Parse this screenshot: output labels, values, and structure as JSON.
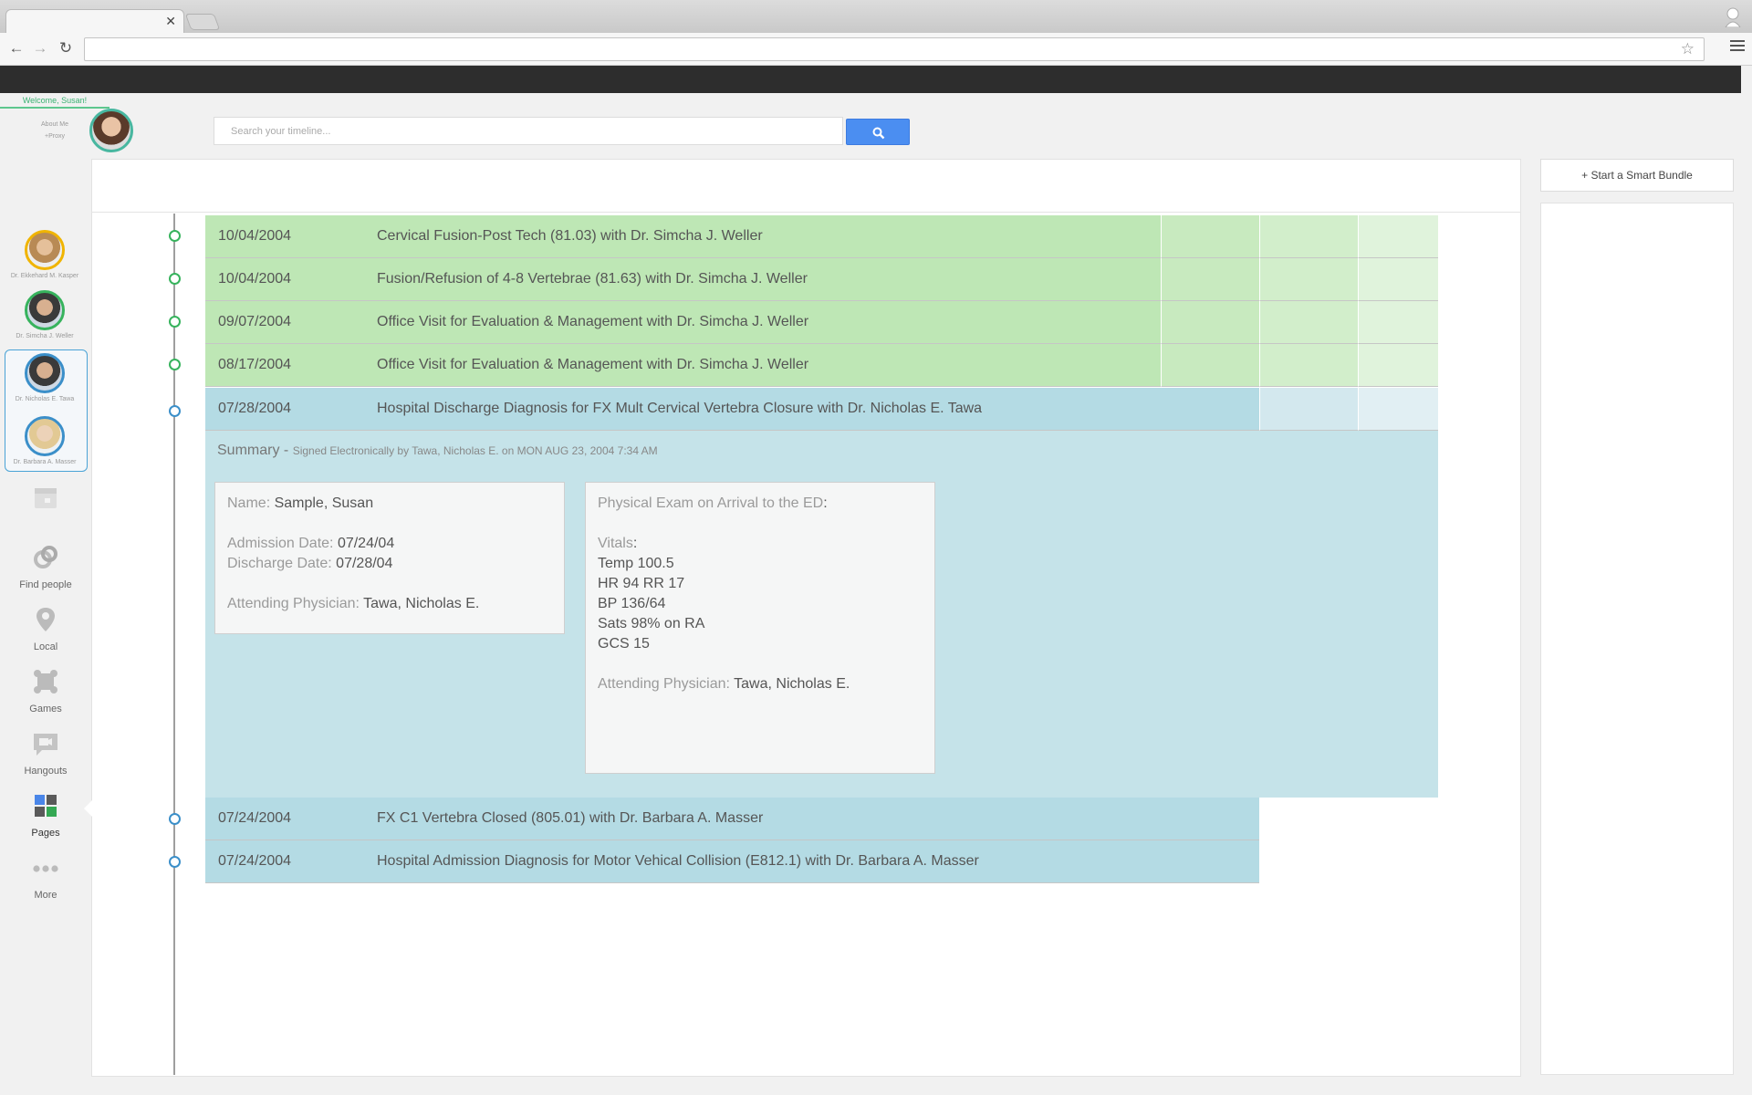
{
  "header": {
    "welcome": "Welcome, Susan!",
    "about_me": "About Me",
    "proxy": "+Proxy",
    "search_placeholder": "Search your timeline..."
  },
  "sidebar": {
    "doctors": [
      {
        "name": "Dr. Ekkehard M. Kasper",
        "ring": "#f0b400"
      },
      {
        "name": "Dr. Simcha J. Weller",
        "ring": "#37b35d"
      },
      {
        "name": "Dr. Nicholas E. Tawa",
        "ring": "#3b8fc9"
      },
      {
        "name": "Dr. Barbara A. Masser",
        "ring": "#3b8fc9"
      }
    ],
    "nav": [
      {
        "label": "Find people",
        "icon": "find-people-icon"
      },
      {
        "label": "Local",
        "icon": "location-pin-icon"
      },
      {
        "label": "Games",
        "icon": "games-puzzle-icon"
      },
      {
        "label": "Hangouts",
        "icon": "hangouts-video-icon"
      },
      {
        "label": "Pages",
        "icon": "pages-icon"
      },
      {
        "label": "More",
        "icon": "more-dots-icon"
      }
    ]
  },
  "timeline": {
    "rows": [
      {
        "date": "10/04/2004",
        "desc": "Cervical Fusion-Post Tech (81.03) with Dr. Simcha J. Weller",
        "color": "green"
      },
      {
        "date": "10/04/2004",
        "desc": "Fusion/Refusion of 4-8 Vertebrae (81.63) with Dr. Simcha J. Weller",
        "color": "green"
      },
      {
        "date": "09/07/2004",
        "desc": "Office Visit for Evaluation & Management with Dr. Simcha J. Weller",
        "color": "green"
      },
      {
        "date": "08/17/2004",
        "desc": "Office Visit for Evaluation & Management with Dr. Simcha J. Weller",
        "color": "green"
      },
      {
        "date": "07/28/2004",
        "desc": "Hospital Discharge Diagnosis for FX Mult Cervical Vertebra Closure with Dr. Nicholas E. Tawa",
        "color": "blue"
      },
      {
        "date": "07/24/2004",
        "desc": "FX C1 Vertebra Closed (805.01) with Dr. Barbara A. Masser",
        "color": "blue"
      },
      {
        "date": "07/24/2004",
        "desc": "Hospital Admission Diagnosis for Motor Vehical Collision (E812.1) with Dr. Barbara A. Masser",
        "color": "blue"
      }
    ],
    "summary": {
      "title": "Summary -",
      "signed": "Signed Electronically by Tawa, Nicholas E. on MON AUG 23, 2004 7:34 AM",
      "card1": {
        "name_label": "Name",
        "name_value": "Sample, Susan",
        "admission_label": "Admission Date",
        "admission_value": "07/24/04",
        "discharge_label": "Discharge Date",
        "discharge_value": "07/28/04",
        "attending_label": "Attending Physician",
        "attending_value": "Tawa, Nicholas E."
      },
      "card2": {
        "exam_label": "Physical Exam on Arrival to the ED",
        "vitals_label": "Vitals",
        "vitals": [
          "Temp 100.5",
          "HR 94 RR 17",
          "BP 136/64",
          "Sats 98% on RA",
          "GCS 15"
        ],
        "attending_label": "Attending Physician",
        "attending_value": "Tawa, Nicholas E."
      }
    }
  },
  "right": {
    "bundle_button": "+ Start a Smart Bundle"
  }
}
